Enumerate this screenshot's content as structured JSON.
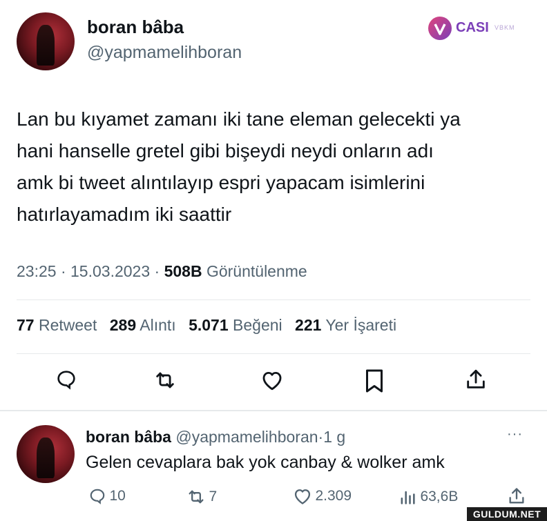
{
  "tweet": {
    "author_name": "boran bâba",
    "author_handle": "@yapmamelihboran",
    "text_lines": [
      "Lan bu kıyamet zamanı iki tane eleman gelecekti ya",
      "hani hanselle gretel gibi bişeydi neydi onların adı",
      "amk bi tweet alıntılayıp espri yapacam isimlerini",
      "hatırlayamadım iki saattir"
    ],
    "time": "23:25",
    "date": "15.03.2023",
    "views_count": "508B",
    "views_label": "Görüntülenme",
    "separator": "·"
  },
  "stats": {
    "retweets_count": "77",
    "retweets_label": "Retweet",
    "quotes_count": "289",
    "quotes_label": "Alıntı",
    "likes_count": "5.071",
    "likes_label": "Beğeni",
    "bookmarks_count": "221",
    "bookmarks_label": "Yer İşareti"
  },
  "reply": {
    "author_name": "boran bâba",
    "author_handle": "@yapmamelihboran",
    "age": "1 g",
    "separator": "·",
    "text": "Gelen cevaplara bak yok canbay & wolker amk",
    "replies": "10",
    "retweets": "7",
    "likes": "2.309",
    "views": "63,6B",
    "more": "···"
  },
  "watermarks": {
    "casi_logo": "CASI",
    "casi_suffix": "VBKM",
    "site": "GULDUM.NET"
  },
  "colors": {
    "text": "#0f1419",
    "muted": "#536471",
    "divider": "#e6e9eb",
    "logo": "#7b3fb8"
  },
  "icons": [
    "reply-icon",
    "retweet-icon",
    "like-icon",
    "bookmark-icon",
    "share-icon",
    "views-icon",
    "more-icon"
  ]
}
